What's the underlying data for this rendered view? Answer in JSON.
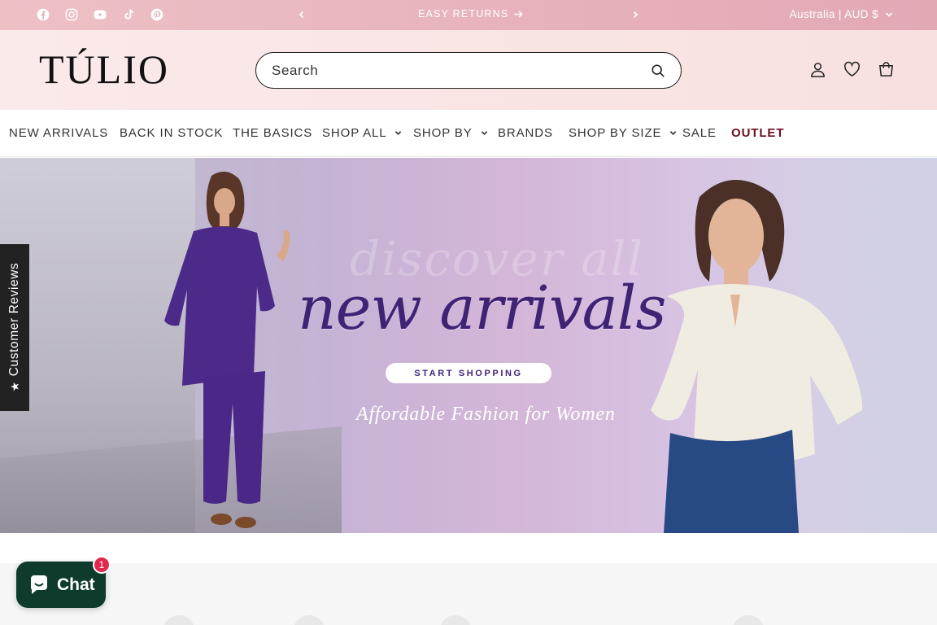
{
  "announcement": {
    "social_icons": [
      "facebook-icon",
      "instagram-icon",
      "youtube-icon",
      "tiktok-icon",
      "pinterest-icon"
    ],
    "message": "EASY RETURNS",
    "locale": "Australia | AUD $"
  },
  "header": {
    "logo": "TÚLIO",
    "search_placeholder": "Search",
    "icons": [
      "account-icon",
      "wishlist-heart-icon",
      "cart-icon"
    ]
  },
  "nav": {
    "items": [
      {
        "label": "NEW ARRIVALS",
        "dropdown": false
      },
      {
        "label": "BACK IN STOCK",
        "dropdown": false
      },
      {
        "label": "THE BASICS",
        "dropdown": false
      },
      {
        "label": "SHOP ALL",
        "dropdown": true
      },
      {
        "label": "SHOP BY",
        "dropdown": true
      },
      {
        "label": "BRANDS",
        "dropdown": false
      },
      {
        "label": "SHOP BY SIZE",
        "dropdown": true
      },
      {
        "label": "SALE",
        "dropdown": false
      },
      {
        "label": "OUTLET",
        "dropdown": false
      }
    ],
    "outlet_color": "#6b0f1f"
  },
  "hero": {
    "ghost_text": "discover all",
    "title": "new arrivals",
    "cta": "START SHOPPING",
    "tagline": "Affordable Fashion for Women",
    "title_color": "#3f2476"
  },
  "reviews_tab": {
    "label": "Customer Reviews",
    "icon": "★"
  },
  "chat": {
    "label": "Chat",
    "badge": "1",
    "color": "#0f3b2d"
  }
}
